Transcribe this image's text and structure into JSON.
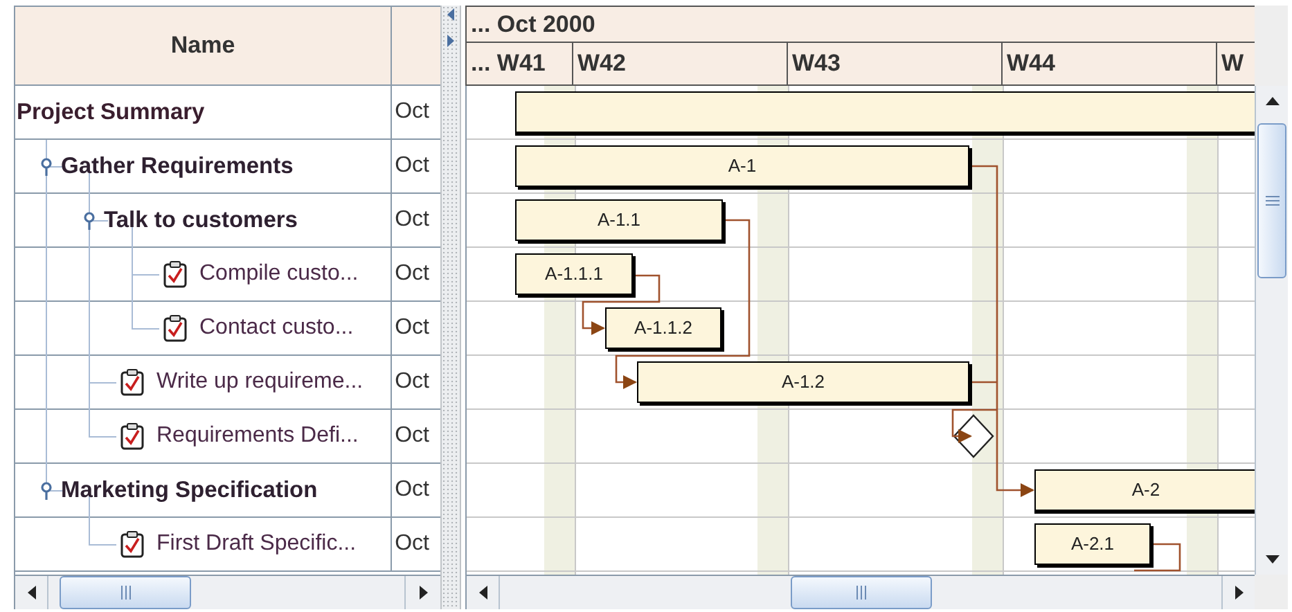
{
  "columns": [
    "Name"
  ],
  "timeline": {
    "month": "... Oct 2000",
    "weeks": [
      "... W41",
      "W42",
      "W43",
      "W44",
      "W"
    ]
  },
  "tasks": [
    {
      "name": "Project Summary",
      "kind": "summary",
      "date": "Oct",
      "bar": {
        "kind": "bar"
      },
      "children": [
        {
          "name": "Gather Requirements",
          "kind": "group",
          "date": "Oct",
          "expanded": true,
          "bar": {
            "kind": "bar",
            "label": "A-1"
          },
          "children": [
            {
              "name": "Talk to customers",
              "kind": "group",
              "date": "Oct",
              "expanded": true,
              "bar": {
                "kind": "bar",
                "label": "A-1.1"
              },
              "children": [
                {
                  "name": "Compile custo...",
                  "kind": "task",
                  "date": "Oct",
                  "bar": {
                    "kind": "bar",
                    "label": "A-1.1.1"
                  }
                },
                {
                  "name": "Contact custo...",
                  "kind": "task",
                  "date": "Oct",
                  "bar": {
                    "kind": "bar",
                    "label": "A-1.1.2"
                  }
                }
              ]
            },
            {
              "name": "Write up requireme...",
              "kind": "task",
              "date": "Oct",
              "bar": {
                "kind": "bar",
                "label": "A-1.2"
              }
            },
            {
              "name": "Requirements Defi...",
              "kind": "task",
              "date": "Oct",
              "bar": {
                "kind": "milestone"
              }
            }
          ]
        },
        {
          "name": "Marketing Specification",
          "kind": "group",
          "date": "Oct",
          "expanded": true,
          "bar": {
            "kind": "bar",
            "label": "A-2"
          },
          "children": [
            {
              "name": "First Draft Specific...",
              "kind": "task",
              "date": "Oct",
              "bar": {
                "kind": "bar",
                "label": "A-2.1"
              }
            }
          ]
        }
      ]
    }
  ]
}
